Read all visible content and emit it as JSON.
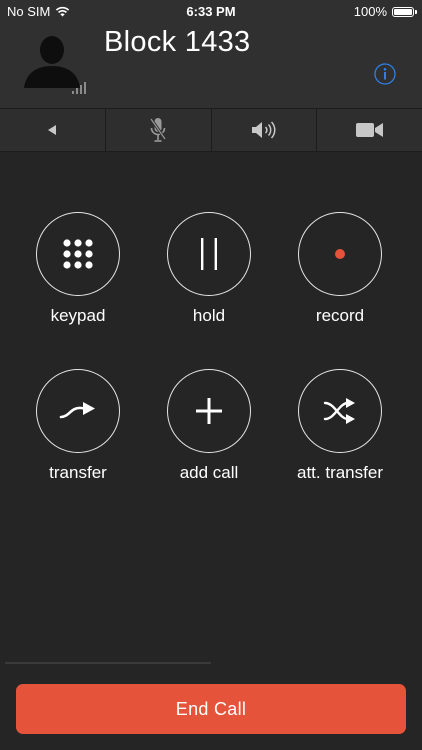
{
  "status_bar": {
    "carrier": "No SIM",
    "time": "6:33 PM",
    "battery_percent": "100%",
    "battery_level": 1.0
  },
  "header": {
    "caller_name": "Block 1433",
    "info_icon": "info-icon",
    "avatar_icon": "person-silhouette-icon",
    "signal_icon": "signal-bars-icon"
  },
  "toolbar": {
    "items": [
      {
        "icon": "back-arrow-icon"
      },
      {
        "icon": "microphone-mute-icon"
      },
      {
        "icon": "speaker-icon"
      },
      {
        "icon": "video-camera-icon"
      }
    ]
  },
  "actions": {
    "keypad": {
      "label": "keypad",
      "icon": "keypad-icon"
    },
    "hold": {
      "label": "hold",
      "icon": "pause-icon"
    },
    "record": {
      "label": "record",
      "icon": "record-icon"
    },
    "transfer": {
      "label": "transfer",
      "icon": "transfer-arrow-icon"
    },
    "add_call": {
      "label": "add call",
      "icon": "plus-icon"
    },
    "att_transfer": {
      "label": "att. transfer",
      "icon": "shuffle-icon"
    }
  },
  "end_call": {
    "label": "End Call"
  },
  "colors": {
    "end_call": "#e4533a",
    "record_dot": "#e4533a",
    "info_accent": "#2f7fe6",
    "background": "#252525"
  }
}
